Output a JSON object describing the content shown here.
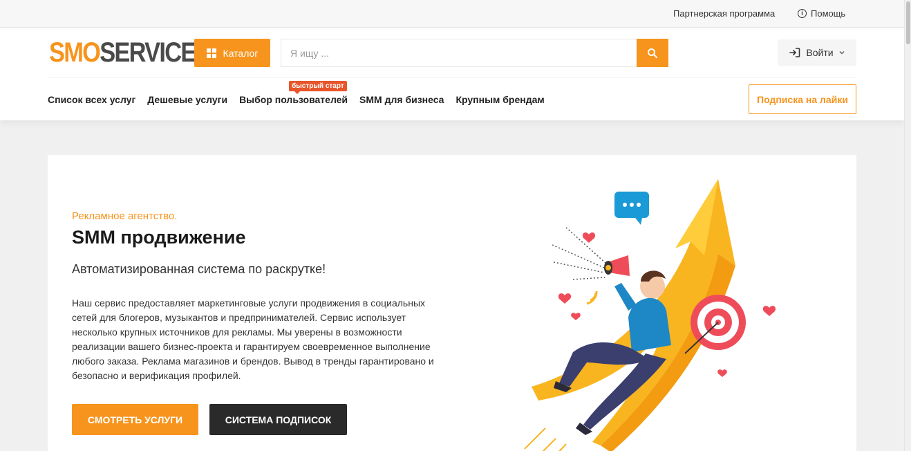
{
  "topbar": {
    "partner": "Партнерская программа",
    "help": "Помощь"
  },
  "header": {
    "logo_part1": "SMO",
    "logo_part2": "SERVICE",
    "catalog": "Каталог",
    "search_placeholder": "Я ищу ...",
    "login": "Войти",
    "subscribe": "Подписка на лайки"
  },
  "nav": {
    "items": [
      {
        "label": "Список всех услуг"
      },
      {
        "label": "Дешевые услуги"
      },
      {
        "label": "Выбор пользователей",
        "badge": "быстрый старт"
      },
      {
        "label": "SMM для бизнеса"
      },
      {
        "label": "Крупным брендам"
      }
    ]
  },
  "hero": {
    "eyebrow": "Рекламное агентство.",
    "title": "SMM продвижение",
    "subtitle": "Автоматизированная система по раскрутке!",
    "text": "Наш сервис предоставляет маркетинговые услуги продвижения в социальных сетей для блогеров, музыкантов и предпринимателей. Сервис использует несколько крупных источников для рекламы. Мы уверены в возможности реализации вашего бизнес-проекта и гарантируем своевременное выполнение любого заказа. Реклама магазинов и брендов. Вывод в тренды гарантировано и безопасно и верификация профилей.",
    "btn_services": "СМОТРЕТЬ УСЛУГИ",
    "btn_subscriptions": "СИСТЕМА ПОДПИСОК"
  },
  "colors": {
    "accent": "#f7941d",
    "badge": "#e8552a",
    "dark_button": "#2a2a2a"
  },
  "icons": {
    "catalog": "grid-icon",
    "search": "search-icon",
    "login": "login-icon",
    "help": "info-icon",
    "dropdown": "chevron-down-icon"
  }
}
